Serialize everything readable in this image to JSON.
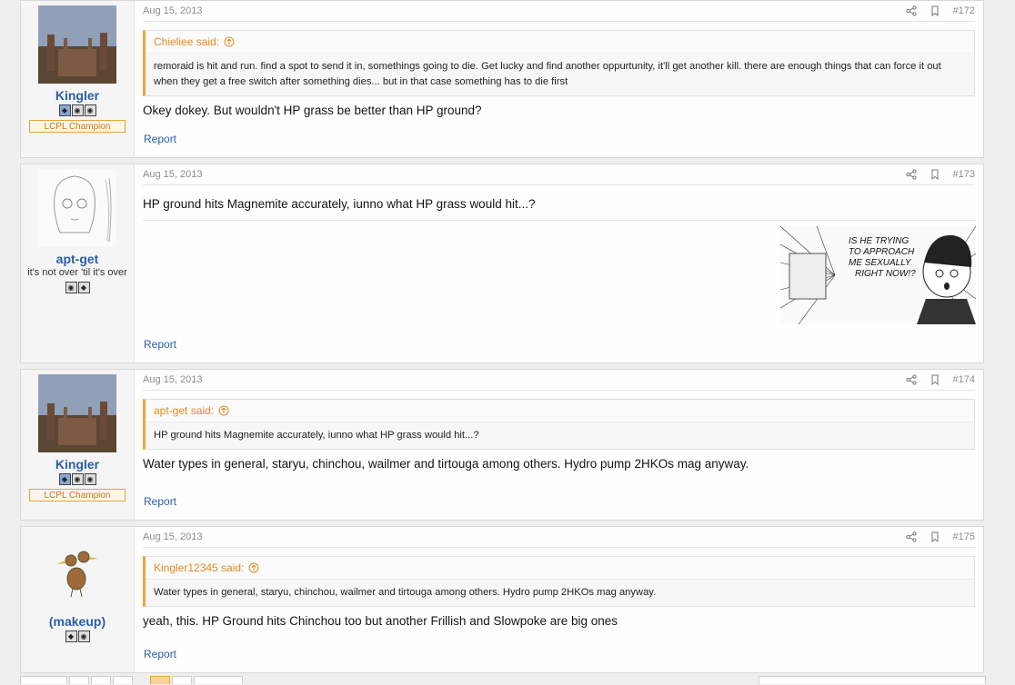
{
  "posts": [
    {
      "date": "Aug 15, 2013",
      "number": "#172",
      "user": {
        "name": "Kingler",
        "title": "",
        "banner": "LCPL Champion",
        "avatar": "factory-power-station-image"
      },
      "quote": {
        "author": "Chieliee said:",
        "text": "remoraid is hit and run. find a spot to send it in, somethings going to die. Get lucky and find another oppurtunity, it'll get another kill. there are enough things that can force it out when they get a free switch after something dies... but in that case something has to die first"
      },
      "message": "Okey dokey. But wouldn't HP grass be better than HP ground?",
      "report": "Report"
    },
    {
      "date": "Aug 15, 2013",
      "number": "#173",
      "user": {
        "name": "apt-get",
        "title": "it's not over 'til it's over",
        "avatar": "manga-girl-sketch"
      },
      "message": "HP ground hits Magnemite accurately, iunno what HP grass would hit...?",
      "signature_image": "manga-panel-girl-shocked",
      "signature_text": "IS HE TRYING TO APPROACH ME SEXUALLY RIGHT NOW!?",
      "report": "Report"
    },
    {
      "date": "Aug 15, 2013",
      "number": "#174",
      "user": {
        "name": "Kingler",
        "banner": "LCPL Champion",
        "avatar": "factory-power-station-image"
      },
      "quote": {
        "author": "apt-get said:",
        "text": "HP ground hits Magnemite accurately, iunno what HP grass would hit...?"
      },
      "message": "Water types in general, staryu, chinchou, wailmer and tirtouga among others. Hydro pump 2HKOs mag anyway.",
      "report": "Report"
    },
    {
      "date": "Aug 15, 2013",
      "number": "#175",
      "user": {
        "name": "(makeup)",
        "avatar": "doduo-sprite"
      },
      "quote": {
        "author": "Kingler12345 said:",
        "text": "Water types in general, staryu, chinchou, wailmer and tirtouga among others. Hydro pump 2HKOs mag anyway."
      },
      "message": "yeah, this. HP Ground hits Chinchou too but another Frillish and Slowpoke are big ones",
      "report": "Report"
    }
  ],
  "icons": {
    "share": "share-icon",
    "bookmark": "bookmark-icon",
    "quote_up": "arrow-up-circle-icon"
  },
  "colors": {
    "link": "#2a5ea8",
    "quote_accent": "#f0a434",
    "banner": "#e3a33d"
  }
}
